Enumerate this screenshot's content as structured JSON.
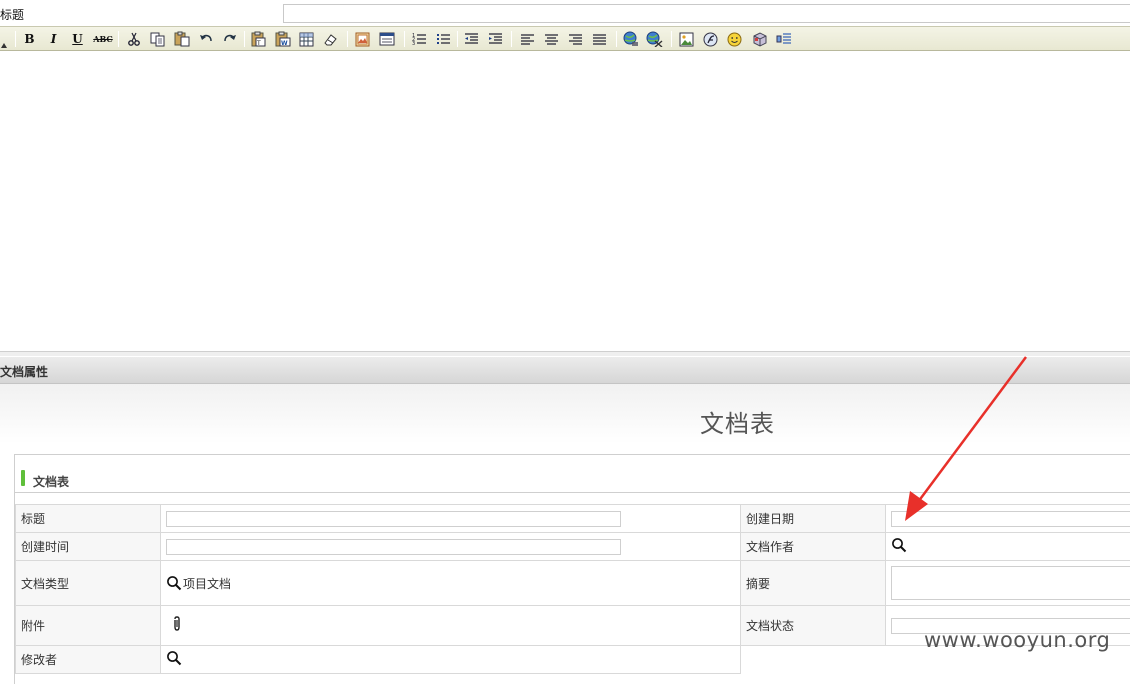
{
  "title_row": {
    "label": "标题",
    "input_value": ""
  },
  "toolbar": {
    "bold": "B",
    "italic": "I",
    "underline": "U",
    "strike": "ABC",
    "icons": [
      "bold-icon",
      "italic-icon",
      "underline-icon",
      "strikethrough-icon",
      "cut-icon",
      "copy-icon",
      "paste-icon",
      "undo-icon",
      "redo-icon",
      "paste-text-icon",
      "paste-word-icon",
      "table-icon",
      "eraser-icon",
      "image-frame-icon",
      "window-icon",
      "ordered-list-icon",
      "unordered-list-icon",
      "outdent-icon",
      "indent-icon",
      "align-left-icon",
      "align-center-icon",
      "align-right-icon",
      "align-justify-icon",
      "link-icon",
      "unlink-icon",
      "picture-icon",
      "flash-icon",
      "emoticon-icon",
      "media-icon",
      "hr-icon"
    ]
  },
  "section": {
    "title": "文档属性"
  },
  "form": {
    "title": "文档表",
    "group_title": "文档表",
    "fields": {
      "title_label": "标题",
      "created_date_label": "创建日期",
      "created_time_label": "创建时间",
      "author_label": "文档作者",
      "doc_type_label": "文档类型",
      "doc_type_value": "项目文档",
      "summary_label": "摘要",
      "attachment_label": "附件",
      "status_label": "文档状态",
      "modifier_label": "修改者"
    }
  },
  "colors": {
    "accent_bar": "#5fbf3a",
    "arrow": "#e8302a",
    "toolbar_bg": "#ecebd8"
  },
  "watermark": "www.wooyun.org"
}
